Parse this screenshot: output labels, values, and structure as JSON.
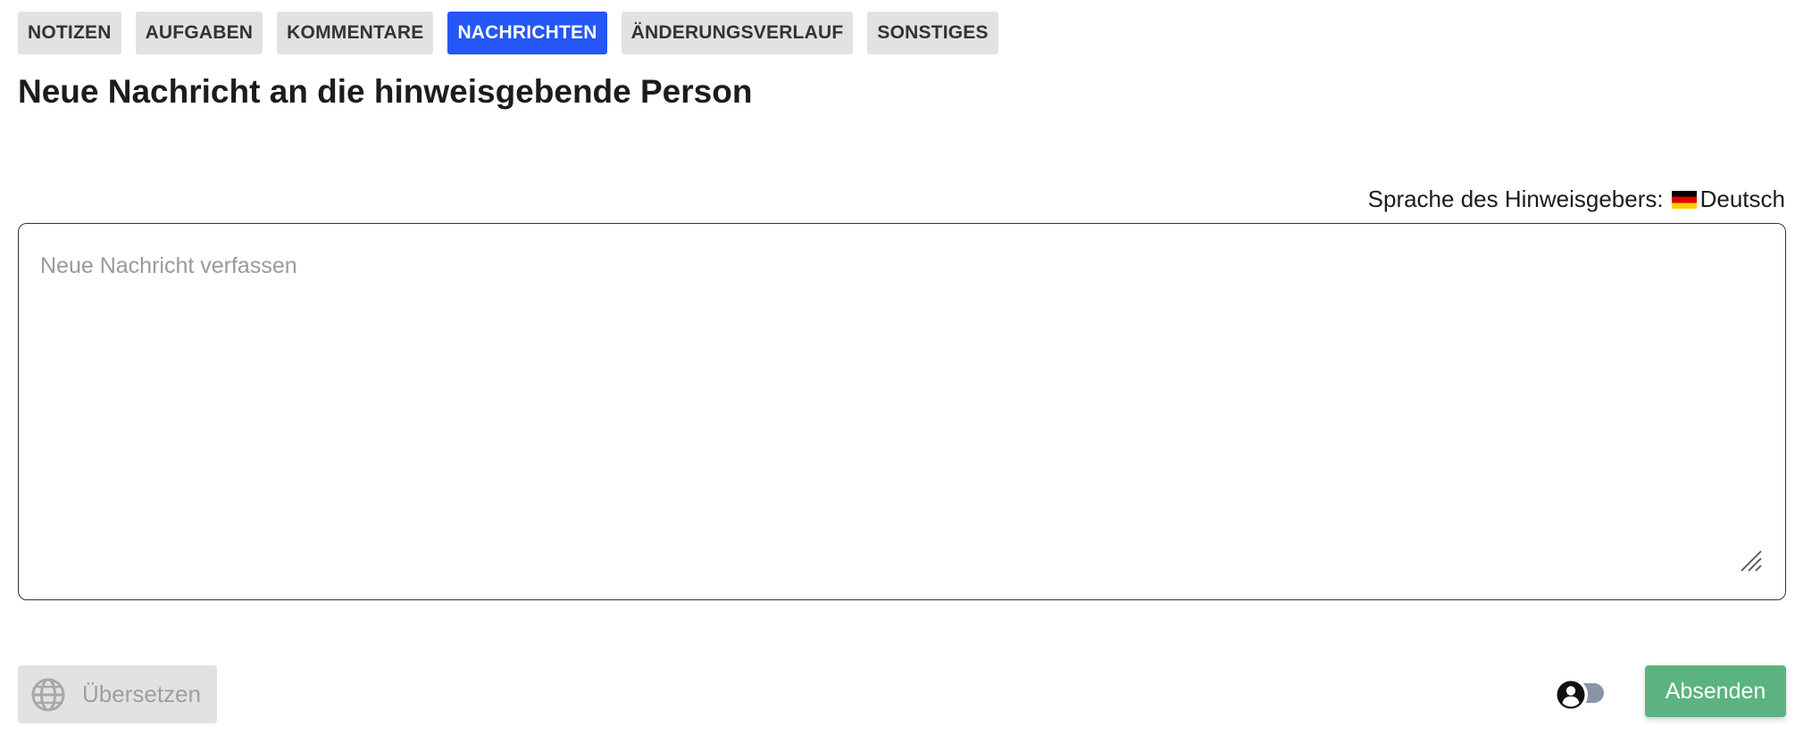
{
  "tabs": [
    {
      "label": "NOTIZEN",
      "active": false
    },
    {
      "label": "AUFGABEN",
      "active": false
    },
    {
      "label": "KOMMENTARE",
      "active": false
    },
    {
      "label": "NACHRICHTEN",
      "active": true
    },
    {
      "label": "ÄNDERUNGSVERLAUF",
      "active": false
    },
    {
      "label": "SONSTIGES",
      "active": false
    }
  ],
  "page_title": "Neue Nachricht an die hinweisgebende Person",
  "language": {
    "label": "Sprache des Hinweisgebers:",
    "flag_icon": "germany-flag-icon",
    "value": "Deutsch"
  },
  "message": {
    "value": "",
    "placeholder": "Neue Nachricht verfassen"
  },
  "translate_button": {
    "label": "Übersetzen",
    "icon": "globe-icon",
    "disabled": true
  },
  "anonymous_toggle": {
    "icon": "user-circle-icon",
    "on": false
  },
  "send_button": {
    "label": "Absenden"
  },
  "colors": {
    "tab_active": "#2457f5",
    "tab_inactive": "#e2e2e2",
    "send": "#5bb381",
    "toggle_track": "#8a94a6"
  }
}
